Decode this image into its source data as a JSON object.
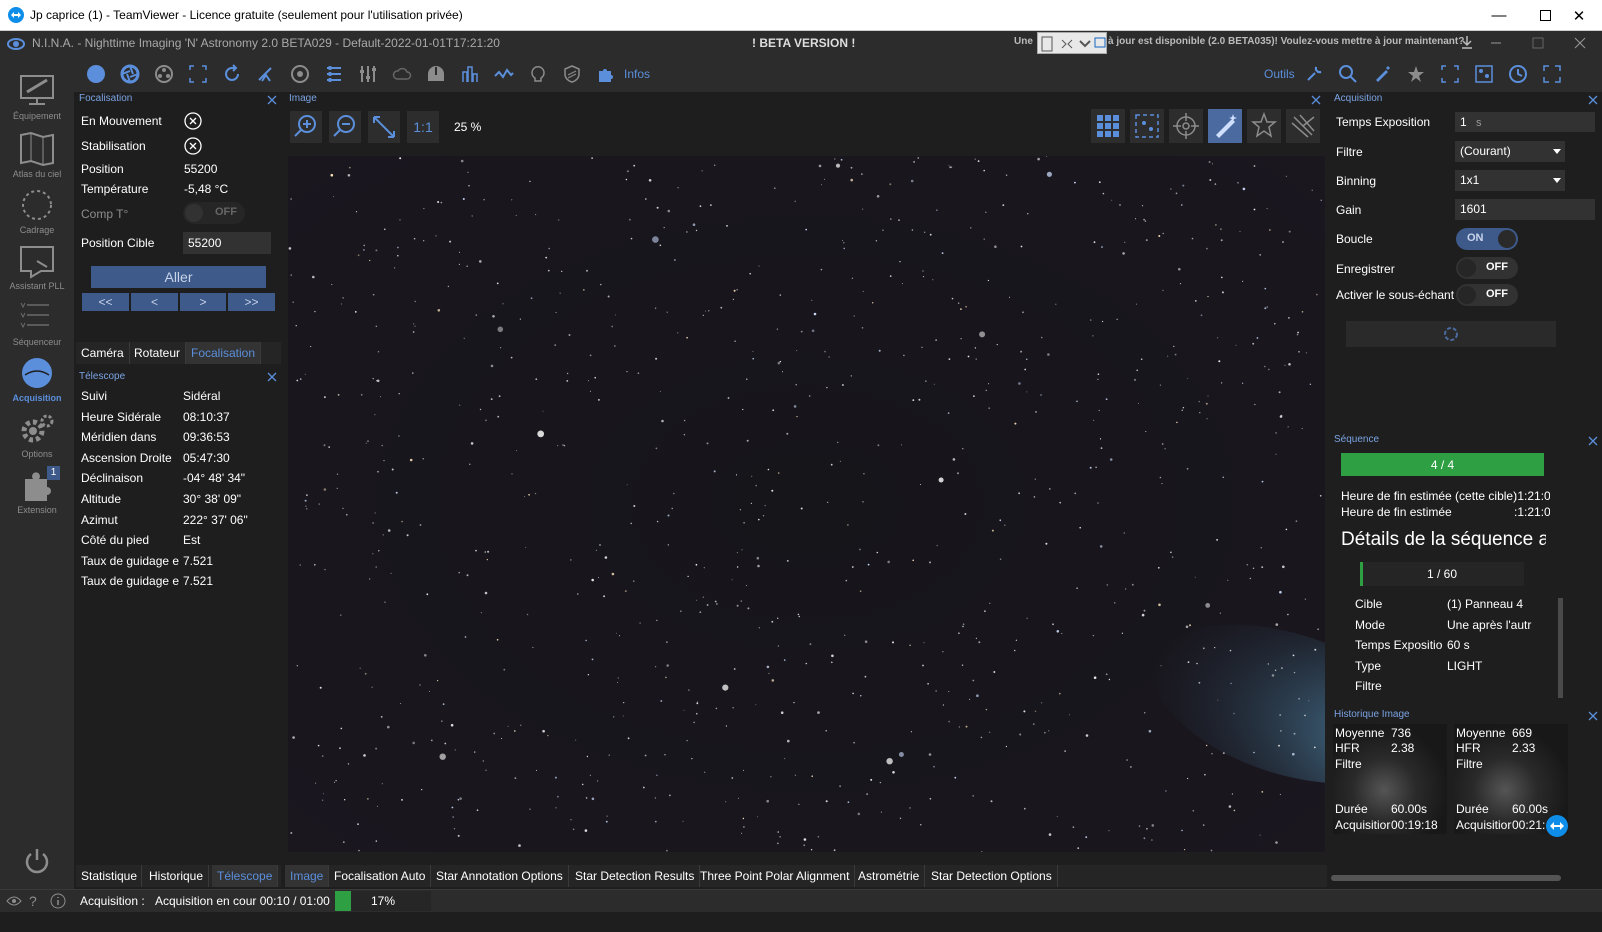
{
  "teamviewer": {
    "title": "Jp caprice (1) - TeamViewer - Licence gratuite (seulement pour l'utilisation privée)"
  },
  "app": {
    "title": "N.I.N.A. - Nighttime Imaging 'N' Astronomy 2.0 BETA029  -  Default-2022-01-01T17:21:20",
    "beta": "! BETA VERSION !",
    "update_prefix": "Une",
    "update_text": "à jour est disponible (2.0 BETA035)! Voulez-vous mettre à jour maintenant?"
  },
  "toolbar": {
    "infos_label": "Infos",
    "outils_label": "Outils"
  },
  "rail": [
    {
      "label": "Équipement",
      "icon": "equipment-icon"
    },
    {
      "label": "Atlas du ciel",
      "icon": "sky-atlas-icon"
    },
    {
      "label": "Cadrage",
      "icon": "framing-icon"
    },
    {
      "label": "Assistant PLL",
      "icon": "flat-wizard-icon"
    },
    {
      "label": "Séquenceur",
      "icon": "sequencer-icon"
    },
    {
      "label": "Acquisition",
      "icon": "acquisition-icon"
    },
    {
      "label": "Options",
      "icon": "gear-icon"
    },
    {
      "label": "Extension",
      "icon": "puzzle-icon",
      "badge": "1"
    }
  ],
  "focuser": {
    "header": "Focalisation",
    "rows": [
      {
        "label": "En Mouvement"
      },
      {
        "label": "Stabilisation"
      }
    ],
    "position_label": "Position",
    "position_value": "55200",
    "temp_label": "Température",
    "temp_value": "-5,48 °C",
    "comp_label": "Comp T°",
    "comp_state": "OFF",
    "target_label": "Position Cible",
    "target_value": "55200",
    "go_label": "Aller",
    "step_buttons": [
      "<<",
      "<",
      ">",
      ">>"
    ],
    "tabs": [
      "Caméra",
      "Rotateur",
      "Focalisation"
    ]
  },
  "telescope": {
    "header": "Télescope",
    "rows": [
      {
        "label": "Suivi",
        "value": "Sidéral"
      },
      {
        "label": "Heure Sidérale",
        "value": "08:10:37"
      },
      {
        "label": "Méridien dans",
        "value": "09:36:53"
      },
      {
        "label": "Ascension Droite",
        "value": "05:47:30"
      },
      {
        "label": "Déclinaison",
        "value": "-04° 48' 34\""
      },
      {
        "label": "Altitude",
        "value": "30° 38' 09\""
      },
      {
        "label": "Azimut",
        "value": "222° 37' 06\""
      },
      {
        "label": "Côté du pied",
        "value": "Est"
      },
      {
        "label": "Taux de guidage er",
        "value": "7.521"
      },
      {
        "label": "Taux de guidage er",
        "value": "7.521"
      }
    ],
    "tabs": [
      "Statistique",
      "Historique",
      "Télescope"
    ]
  },
  "image": {
    "header": "Image",
    "zoom_label": "1:1",
    "zoom_percent": "25 %",
    "tabs": [
      "Image",
      "Focalisation Auto",
      "Star Annotation Options",
      "Star Detection Results",
      "Three Point Polar Alignment",
      "Astrométrie",
      "Star Detection Options"
    ]
  },
  "acquisition": {
    "header": "Acquisition",
    "exposure_label": "Temps Exposition",
    "exposure_value": "1",
    "exposure_unit": "s",
    "filter_label": "Filtre",
    "filter_value": "(Courant)",
    "binning_label": "Binning",
    "binning_value": "1x1",
    "gain_label": "Gain",
    "gain_value": "1601",
    "loop_label": "Boucle",
    "loop_state": "ON",
    "save_label": "Enregistrer",
    "save_state": "OFF",
    "subsample_label": "Activer le sous-échant",
    "subsample_state": "OFF"
  },
  "sequence": {
    "header": "Séquence",
    "progress_text": "4 / 4",
    "progress": 1.0,
    "end_target_label": "Heure de fin estimée (cette cible)",
    "end_target_value": ":1:21:0",
    "end_label": "Heure de fin estimée",
    "end_value": ":1:21:0",
    "details_title": "Détails de la séquence a",
    "sub_progress_text": "1 / 60",
    "sub_progress": 0.0167,
    "rows": [
      {
        "label": "Cible",
        "value": "(1) Panneau 4"
      },
      {
        "label": "Mode",
        "value": "Une après l'autr"
      },
      {
        "label": "Temps Expositior",
        "value": "60 s"
      },
      {
        "label": "Type",
        "value": "LIGHT"
      },
      {
        "label": "Filtre",
        "value": ""
      }
    ]
  },
  "history": {
    "header": "Historique Image",
    "cards": [
      {
        "mean_label": "Moyenne",
        "mean": "736",
        "hfr_label": "HFR",
        "hfr": "2.38",
        "filter_label": "Filtre",
        "duration_label": "Durée",
        "duration": "60.00s",
        "acq_label": "Acquisitior",
        "acq": "00:19:18"
      },
      {
        "mean_label": "Moyenne",
        "mean": "669",
        "hfr_label": "HFR",
        "hfr": "2.33",
        "filter_label": "Filtre",
        "duration_label": "Durée",
        "duration": "60.00s",
        "acq_label": "Acquisitior",
        "acq": "00:21:"
      }
    ]
  },
  "status": {
    "label": "Acquisition :",
    "text": "Acquisition en cour 00:10 / 01:00",
    "percent": "17%",
    "progress": 0.17
  },
  "colors": {
    "accent": "#5b8fdc",
    "progress_green": "#2ea043",
    "panel_bg": "#1e1e1e",
    "chrome_bg": "#2c2c2c"
  }
}
